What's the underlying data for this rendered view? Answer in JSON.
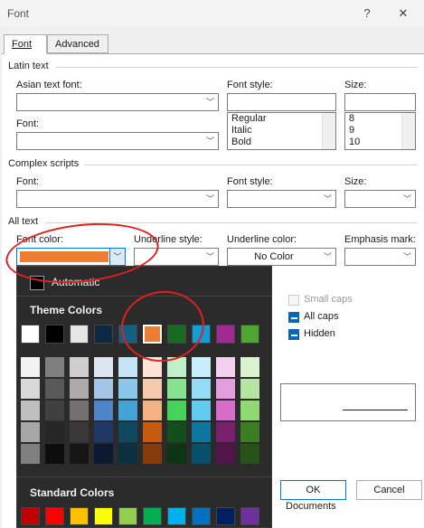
{
  "window": {
    "title": "Font",
    "help": "?",
    "close": "✕"
  },
  "tabs": [
    "Font",
    "Advanced"
  ],
  "latin_text": {
    "heading": "Latin text",
    "asian_font_label": "Asian text font:",
    "font_label": "Font:",
    "font_style_label": "Font style:",
    "size_label": "Size:",
    "font_style_options": [
      "Regular",
      "Italic",
      "Bold"
    ],
    "size_options": [
      "8",
      "9",
      "10"
    ]
  },
  "complex_scripts": {
    "heading": "Complex scripts",
    "font_label": "Font:",
    "font_style_label": "Font style:",
    "size_label": "Size:"
  },
  "all_text": {
    "heading": "All text",
    "font_color_label": "Font color:",
    "underline_style_label": "Underline style:",
    "underline_color_label": "Underline color:",
    "underline_color_value": "No Color",
    "emphasis_mark_label": "Emphasis mark:"
  },
  "effects": {
    "small_caps": "Small caps",
    "all_caps": "All caps",
    "hidden": "Hidden"
  },
  "buttons": {
    "ok": "OK",
    "cancel": "Cancel"
  },
  "color_panel": {
    "automatic_label": "Automatic",
    "theme_heading": "Theme Colors",
    "standard_heading": "Standard Colors",
    "theme_colors": [
      "#ffffff",
      "#000000",
      "#e7e6e6",
      "#0e2841",
      "#156082",
      "#ed7d31",
      "#196b24",
      "#0f9ed5",
      "#a02b93",
      "#4ea72e"
    ],
    "selected_index": 5,
    "shades": [
      [
        "#f2f2f2",
        "#d9d9d9",
        "#bfbfbf",
        "#a6a6a6",
        "#808080"
      ],
      [
        "#7f7f7f",
        "#595959",
        "#404040",
        "#262626",
        "#0d0d0d"
      ],
      [
        "#d0cece",
        "#aeaaaa",
        "#757070",
        "#3b3838",
        "#171616"
      ],
      [
        "#dce6f1",
        "#a6c3e8",
        "#4d86c8",
        "#1f3864",
        "#0b1a30"
      ],
      [
        "#c4e3f5",
        "#8ac7eb",
        "#44a3d9",
        "#104862",
        "#0a3041"
      ],
      [
        "#fbe4d5",
        "#f7caac",
        "#f4b183",
        "#c55a11",
        "#843c0c"
      ],
      [
        "#c1f0c8",
        "#84e291",
        "#47d359",
        "#124f1a",
        "#0c3512"
      ],
      [
        "#caeefb",
        "#95dcf7",
        "#61cbf3",
        "#0b769f",
        "#074f6a"
      ],
      [
        "#f2cfee",
        "#e59edc",
        "#d86dcb",
        "#77206d",
        "#501549"
      ],
      [
        "#d9f2d0",
        "#b4e5a2",
        "#8ed973",
        "#3a7d22",
        "#275317"
      ]
    ],
    "standard_colors": [
      "#c00000",
      "#ff0000",
      "#ffc000",
      "#ffff00",
      "#92d050",
      "#00b050",
      "#00b0f0",
      "#0070c0",
      "#002060",
      "#7030a0"
    ]
  },
  "background": {
    "taskbar_item": "Documents"
  },
  "accent_color": "#0078d4",
  "annotation_color": "#e02020"
}
